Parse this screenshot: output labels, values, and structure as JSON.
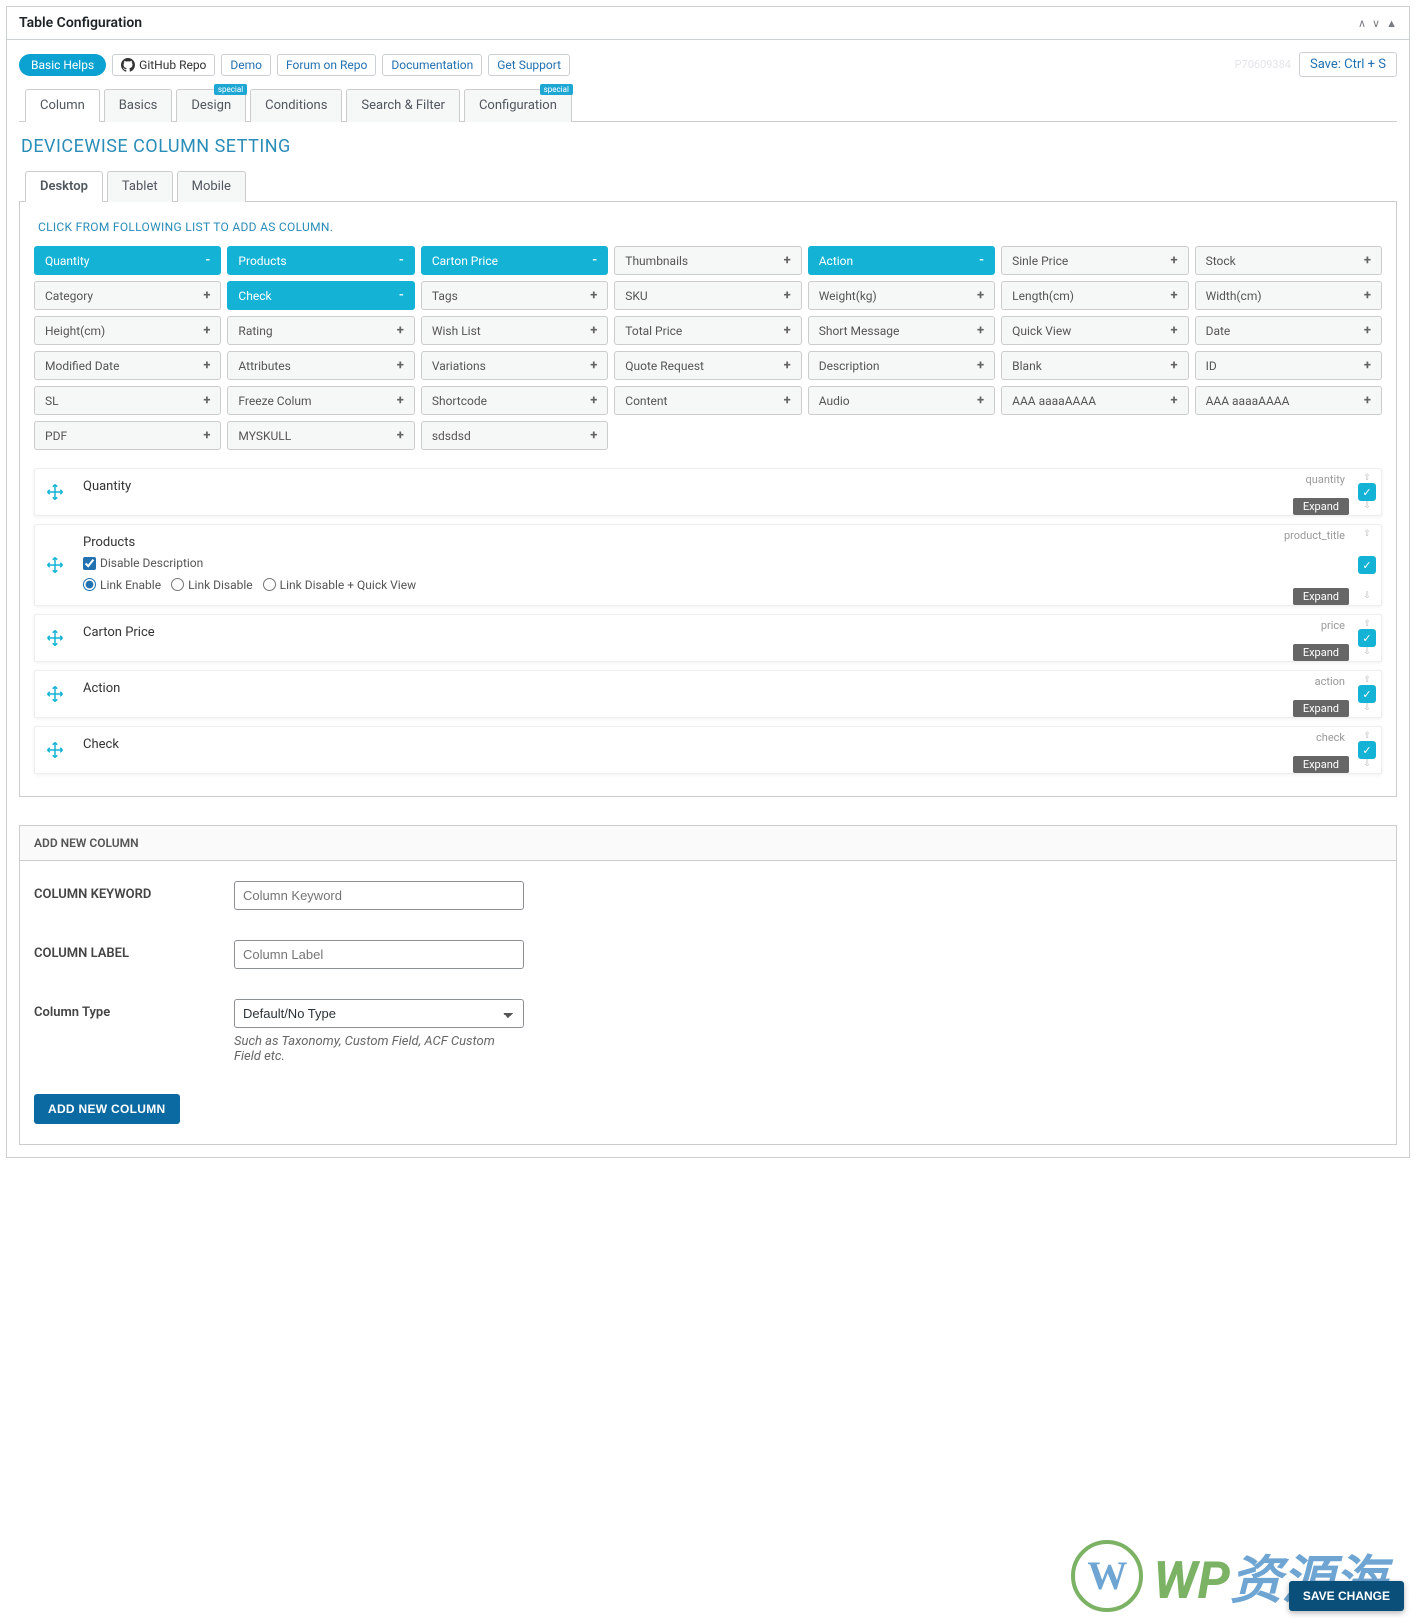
{
  "meta": {
    "title": "Table Configuration"
  },
  "toplinks": {
    "basic": "Basic Helps",
    "github": "GitHub Repo",
    "items": [
      "Demo",
      "Forum on Repo",
      "Documentation",
      "Get Support"
    ],
    "faded_id": "P70609384",
    "save_hint": "Save: Ctrl + S"
  },
  "main_tabs": [
    {
      "label": "Column",
      "active": true
    },
    {
      "label": "Basics"
    },
    {
      "label": "Design",
      "badge": "special"
    },
    {
      "label": "Conditions"
    },
    {
      "label": "Search & Filter"
    },
    {
      "label": "Configuration",
      "badge": "special"
    }
  ],
  "section_title": "DEVICEWISE COLUMN SETTING",
  "device_tabs": [
    {
      "label": "Desktop",
      "active": true
    },
    {
      "label": "Tablet"
    },
    {
      "label": "Mobile"
    }
  ],
  "hint": "CLICK FROM FOLLOWING LIST TO ADD AS COLUMN.",
  "chips": [
    {
      "label": "Quantity",
      "selected": true
    },
    {
      "label": "Products",
      "selected": true
    },
    {
      "label": "Carton Price",
      "selected": true
    },
    {
      "label": "Thumbnails"
    },
    {
      "label": "Action",
      "selected": true
    },
    {
      "label": "Sinle Price"
    },
    {
      "label": "Stock"
    },
    {
      "label": "Category"
    },
    {
      "label": "Check",
      "selected": true
    },
    {
      "label": "Tags"
    },
    {
      "label": "SKU"
    },
    {
      "label": "Weight(kg)"
    },
    {
      "label": "Length(cm)"
    },
    {
      "label": "Width(cm)"
    },
    {
      "label": "Height(cm)"
    },
    {
      "label": "Rating"
    },
    {
      "label": "Wish List"
    },
    {
      "label": "Total Price"
    },
    {
      "label": "Short Message"
    },
    {
      "label": "Quick View"
    },
    {
      "label": "Date"
    },
    {
      "label": "Modified Date"
    },
    {
      "label": "Attributes"
    },
    {
      "label": "Variations"
    },
    {
      "label": "Quote Request"
    },
    {
      "label": "Description"
    },
    {
      "label": "Blank"
    },
    {
      "label": "ID"
    },
    {
      "label": "SL"
    },
    {
      "label": "Freeze Colum"
    },
    {
      "label": "Shortcode"
    },
    {
      "label": "Content"
    },
    {
      "label": "Audio"
    },
    {
      "label": "AAA aaaaAAAA"
    },
    {
      "label": "AAA aaaaAAAA"
    },
    {
      "label": "PDF"
    },
    {
      "label": "MYSKULL"
    },
    {
      "label": "sdsdsd"
    }
  ],
  "rows": [
    {
      "title": "Quantity",
      "slug": "quantity",
      "expand": "Expand"
    },
    {
      "title": "Products",
      "slug": "product_title",
      "expand": "Expand",
      "options": {
        "disable_desc": "Disable Description",
        "r1": "Link Enable",
        "r2": "Link Disable",
        "r3": "Link Disable + Quick View"
      }
    },
    {
      "title": "Carton Price",
      "slug": "price",
      "expand": "Expand"
    },
    {
      "title": "Action",
      "slug": "action",
      "expand": "Expand"
    },
    {
      "title": "Check",
      "slug": "check",
      "expand": "Expand"
    }
  ],
  "add": {
    "header": "ADD NEW COLUMN",
    "keyword_label": "COLUMN KEYWORD",
    "keyword_placeholder": "Column Keyword",
    "label_label": "COLUMN LABEL",
    "label_placeholder": "Column Label",
    "type_label": "Column Type",
    "type_value": "Default/No Type",
    "type_help": "Such as Taxonomy, Custom Field, ACF Custom Field etc.",
    "button": "ADD NEW COLUMN"
  },
  "watermark": {
    "text_a": "WP",
    "text_b": "资源海"
  },
  "save_change": "SAVE CHANGE"
}
